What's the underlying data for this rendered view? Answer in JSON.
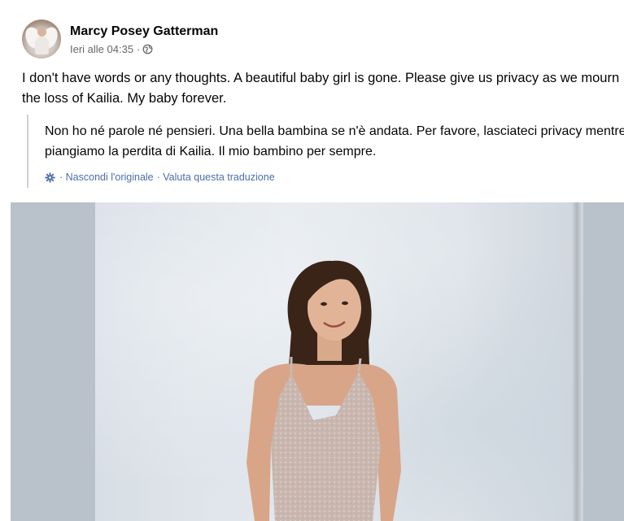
{
  "post": {
    "author": "Marcy Posey Gatterman",
    "timestamp": "Ieri alle 04:35",
    "separator": "·",
    "privacy_icon": "globe-icon",
    "text": "I don't have words or any thoughts. A beautiful baby girl is gone. Please give us privacy as we mourn the loss of Kailia. My baby forever.",
    "translation": {
      "text": "Non ho né parole né pensieri. Una bella bambina se n'è andata. Per favore, lasciateci privacy mentre piangiamo la perdita di Kailia. Il mio bambino per sempre.",
      "icon": "gear-icon",
      "hide_original_label": "· Nascondi l'originale",
      "rate_label": "· Valuta questa traduzione"
    }
  },
  "colors": {
    "link": "#4b6fa8",
    "secondary_text": "#65676b"
  }
}
